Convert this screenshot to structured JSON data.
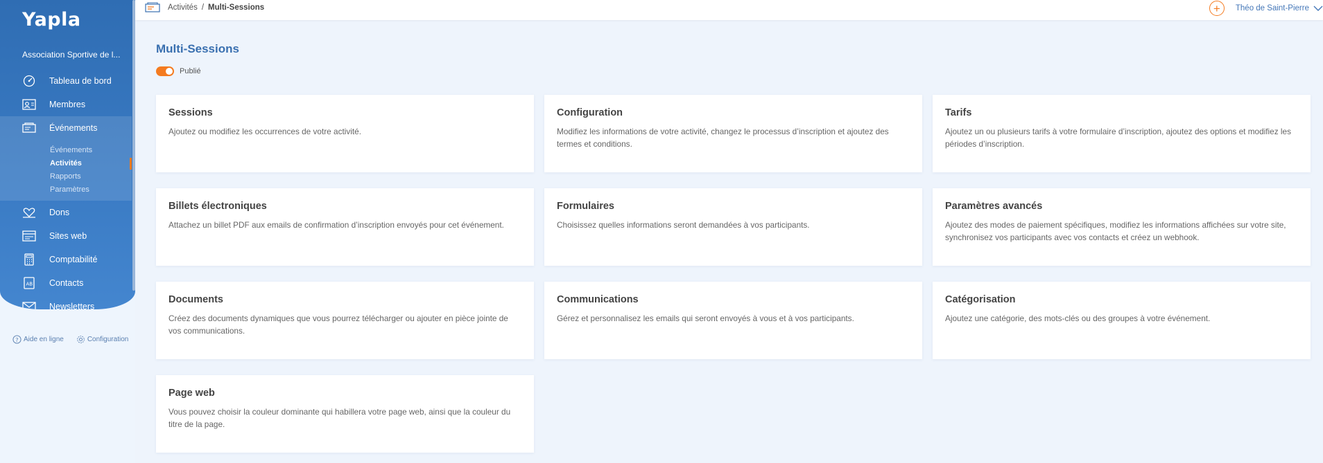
{
  "sidebar": {
    "logo": "Yapla",
    "org_name": "Association Sportive de l...",
    "items": [
      {
        "label": "Tableau de bord",
        "icon": "dashboard-icon"
      },
      {
        "label": "Membres",
        "icon": "members-icon"
      },
      {
        "label": "Événements",
        "icon": "events-icon"
      },
      {
        "label": "Dons",
        "icon": "donations-icon"
      },
      {
        "label": "Sites web",
        "icon": "website-icon"
      },
      {
        "label": "Comptabilité",
        "icon": "accounting-icon"
      },
      {
        "label": "Contacts",
        "icon": "contacts-icon"
      },
      {
        "label": "Newsletters",
        "icon": "newsletter-icon"
      }
    ],
    "subitems": [
      {
        "label": "Événements"
      },
      {
        "label": "Activités"
      },
      {
        "label": "Rapports"
      },
      {
        "label": "Paramètres"
      }
    ],
    "footer": {
      "help": "Aide en ligne",
      "config": "Configuration"
    }
  },
  "topbar": {
    "breadcrumb_parent": "Activités",
    "breadcrumb_sep": "/",
    "breadcrumb_current": "Multi-Sessions",
    "user_name": "Théo de Saint-Pierre",
    "plus": "+"
  },
  "main": {
    "title": "Multi-Sessions",
    "status": "Publié",
    "cards": [
      {
        "title": "Sessions",
        "desc": "Ajoutez ou modifiez les occurrences de votre activité."
      },
      {
        "title": "Configuration",
        "desc": "Modifiez les informations de votre activité, changez le processus d’inscription et ajoutez des termes et conditions."
      },
      {
        "title": "Tarifs",
        "desc": "Ajoutez un ou plusieurs tarifs à votre formulaire d’inscription, ajoutez des options et modifiez les périodes d’inscription."
      },
      {
        "title": "Billets électroniques",
        "desc": "Attachez un billet PDF aux emails de confirmation d’inscription envoyés pour cet événement."
      },
      {
        "title": "Formulaires",
        "desc": "Choisissez quelles informations seront demandées à vos participants."
      },
      {
        "title": "Paramètres avancés",
        "desc": "Ajoutez des modes de paiement spécifiques, modifiez les informations affichées sur votre site, synchronisez vos participants avec vos contacts et créez un webhook."
      },
      {
        "title": "Documents",
        "desc": "Créez des documents dynamiques que vous pourrez télécharger ou ajouter en pièce jointe de vos communications."
      },
      {
        "title": "Communications",
        "desc": "Gérez et personnalisez les emails qui seront envoyés à vous et à vos participants."
      },
      {
        "title": "Catégorisation",
        "desc": "Ajoutez une catégorie, des mots-clés ou des groupes à votre événement."
      },
      {
        "title": "Page web",
        "desc": "Vous pouvez choisir la couleur dominante qui habillera votre page web, ainsi que la couleur du titre de la page."
      }
    ]
  },
  "colors": {
    "accent": "#f47b20",
    "sidebar": "#3a7bc4",
    "title": "#3a70b0"
  }
}
